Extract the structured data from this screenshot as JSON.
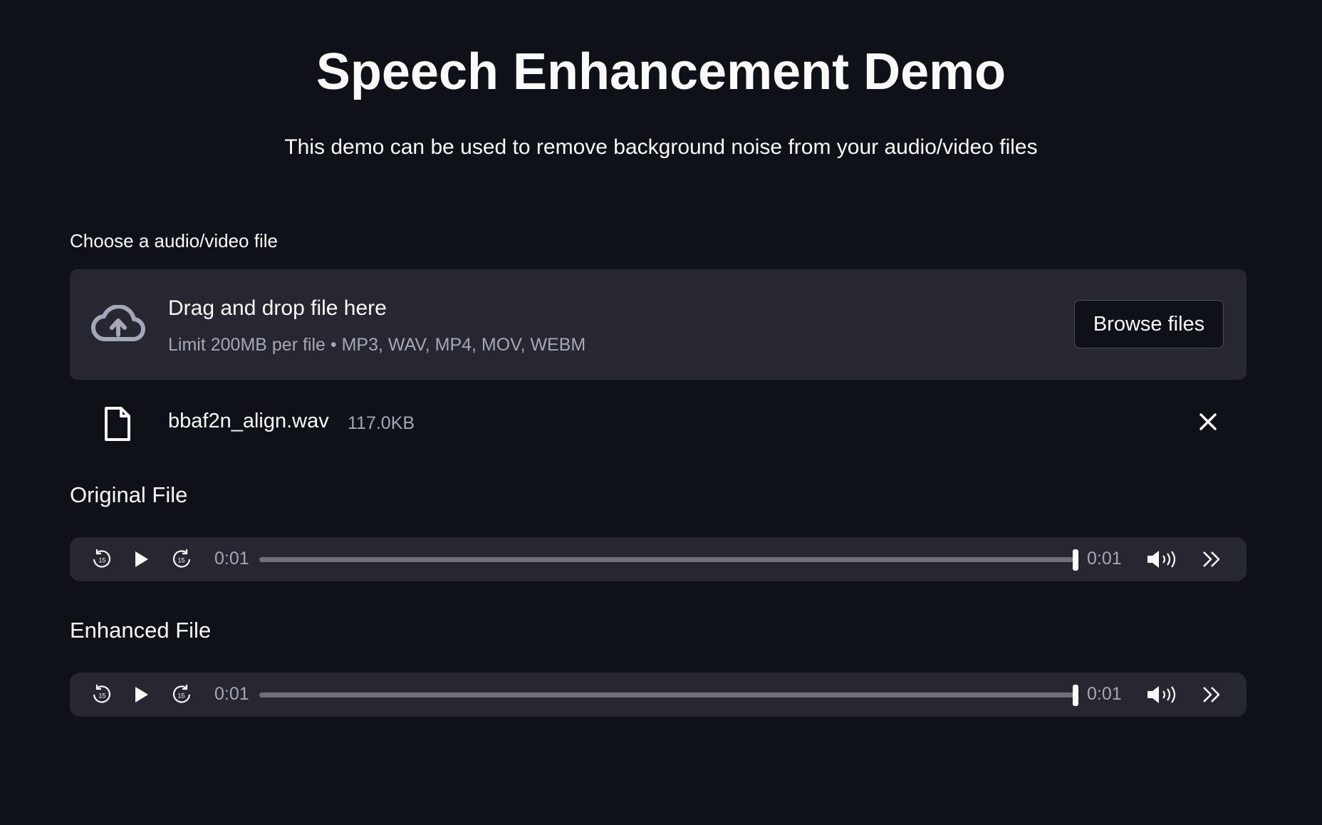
{
  "header": {
    "title": "Speech Enhancement Demo",
    "subtitle": "This demo can be used to remove background noise from your audio/video files"
  },
  "uploader": {
    "label": "Choose a audio/video file",
    "drop_title": "Drag and drop file here",
    "limits": "Limit 200MB per file • MP3, WAV, MP4, MOV, WEBM",
    "browse_label": "Browse files",
    "icon": "cloud-upload-icon"
  },
  "uploaded_file": {
    "name": "bbaf2n_align.wav",
    "size": "117.0KB",
    "icon": "file-icon"
  },
  "players": [
    {
      "heading": "Original File",
      "current_time": "0:01",
      "duration": "0:01",
      "progress": 1.0,
      "skip_seconds": "15"
    },
    {
      "heading": "Enhanced File",
      "current_time": "0:01",
      "duration": "0:01",
      "progress": 1.0,
      "skip_seconds": "15"
    }
  ],
  "colors": {
    "background": "#0e1117",
    "panel": "#262730",
    "text": "#fafafa",
    "muted_text": "#a3a8b8"
  }
}
